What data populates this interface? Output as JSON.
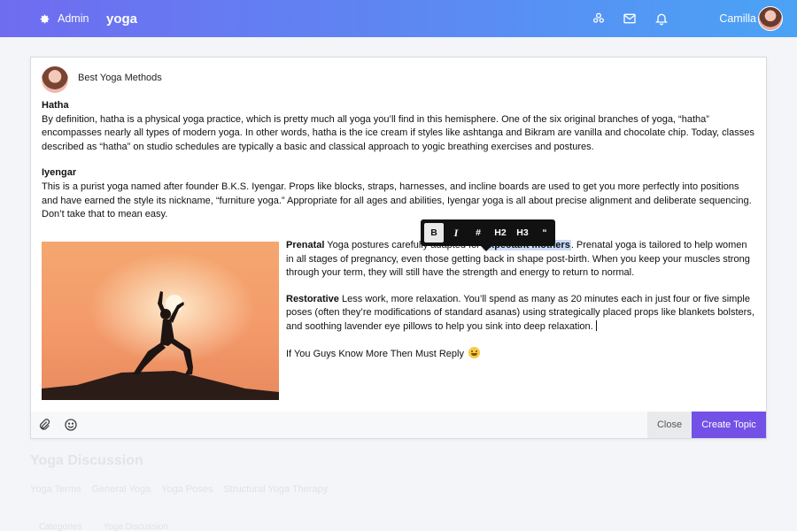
{
  "topbar": {
    "admin_label": "Admin",
    "brand": "yoga",
    "user_name": "Camilla",
    "icons": [
      "settings-gear-icon",
      "users-icon",
      "mail-icon",
      "bell-icon"
    ]
  },
  "editor": {
    "title": "Best Yoga Methods",
    "sections": [
      {
        "heading": "Hatha",
        "body": "By definition, hatha is a physical yoga practice, which is pretty much all yoga you’ll find in this hemisphere. One of the six original branches of yoga, “hatha” encompasses nearly all types of modern yoga. In other words, hatha is the ice cream if styles like ashtanga and Bikram are vanilla and chocolate chip. Today, classes described as “hatha” on studio schedules are typically a basic and classical approach to yogic breathing exercises and postures."
      },
      {
        "heading": "Iyengar",
        "body": "This is a purist yoga named after founder B.K.S. Iyengar. Props like blocks, straps, harnesses, and incline boards are used to get you more perfectly into positions and have earned the style its nickname, “furniture yoga.” Appropriate for all ages and abilities, Iyengar yoga is all about precise alignment and deliberate sequencing. Don’t take that to mean easy."
      }
    ],
    "prenatal": {
      "heading": "Prenatal",
      "before": "Yoga postures carefully adapted for ",
      "highlight": "expectant mothers",
      "after": ". Prenatal yoga is tailored to help women in all stages of pregnancy, even those getting back in shape post-birth. When you keep your muscles strong through your term, they will still have the strength and energy to return to normal."
    },
    "restorative": {
      "heading": "Restorative",
      "body": "Less work, more relaxation. You’ll spend as many as 20 minutes each in just four or five simple poses (often they’re modifications of standard asanas) using strategically placed props like blankets bolsters, and soothing lavender eye pillows to help you sink into deep relaxation."
    },
    "closing": "If You Guys Know More Then Must Reply",
    "toolbar": [
      "B",
      "I",
      "#",
      "H2",
      "H3",
      "“"
    ],
    "close_label": "Close",
    "create_label": "Create Topic",
    "accent": "#7350e6"
  },
  "background": {
    "section_title": "Yoga Discussion",
    "tabs": [
      "Yoga Terms",
      "General Yoga",
      "Yoga Poses",
      "Structural Yoga Therapy"
    ],
    "crumbs": [
      "Categories",
      "Yoga Discussion"
    ]
  }
}
